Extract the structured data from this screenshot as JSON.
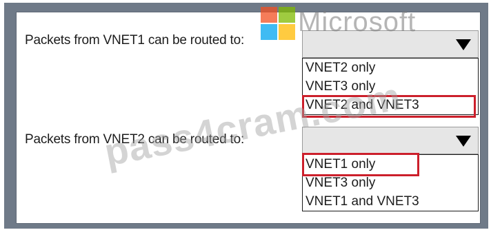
{
  "questions": [
    {
      "prompt": "Packets from VNET1 can be routed to:",
      "options": [
        "VNET2 only",
        "VNET3 only",
        "VNET2 and VNET3"
      ],
      "selected_index": 2
    },
    {
      "prompt": "Packets from VNET2 can be routed to:",
      "options": [
        "VNET1 only",
        "VNET3 only",
        "VNET1 and VNET3"
      ],
      "selected_index": 0
    }
  ],
  "watermarks": {
    "logo_text": "Microsoft",
    "site_text": "pass4cram.com"
  },
  "colors": {
    "frame": "#6f7a88",
    "dropdown_bg": "#e6e6e6",
    "selection_border": "#cc1f2b",
    "logo_red": "#f25022",
    "logo_green": "#7fba00",
    "logo_blue": "#00a4ef",
    "logo_yellow": "#ffb900"
  },
  "icons": {
    "dropdown_arrow": "triangle-down"
  }
}
